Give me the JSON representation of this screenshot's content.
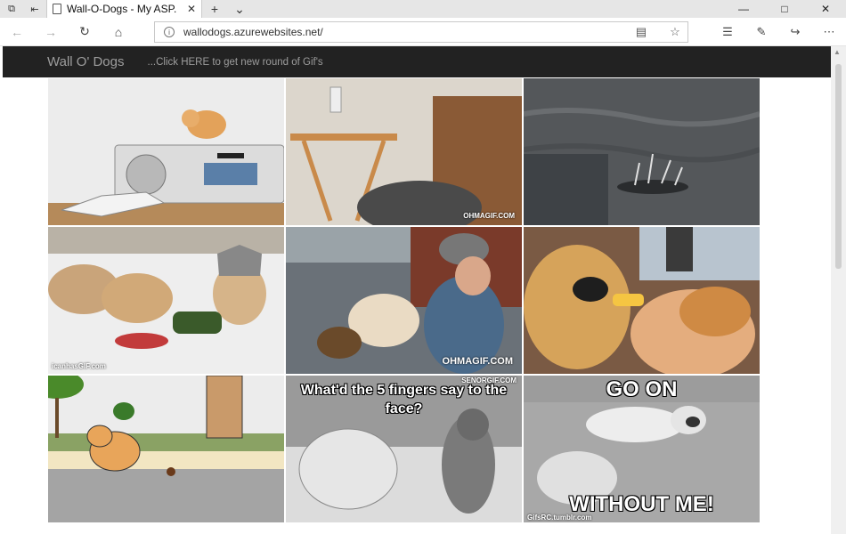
{
  "browser": {
    "tab_title": "Wall-O-Dogs - My ASP.",
    "url": "wallodogs.azurewebsites.net/"
  },
  "site": {
    "brand": "Wall O' Dogs",
    "refresh_link": "...Click HERE to get new round of Gif's"
  },
  "tiles": [
    {
      "caption_top": "",
      "caption_bottom": "",
      "watermark": ""
    },
    {
      "caption_top": "",
      "caption_bottom": "",
      "watermark": "OHMAGIF.COM"
    },
    {
      "caption_top": "",
      "caption_bottom": "",
      "watermark": ""
    },
    {
      "caption_top": "",
      "caption_bottom": "",
      "watermark": "icanhasGIF.com"
    },
    {
      "caption_top": "",
      "caption_bottom": "",
      "watermark": "OHMAGIF.COM"
    },
    {
      "caption_top": "",
      "caption_bottom": "",
      "watermark": ""
    },
    {
      "caption_top": "",
      "caption_bottom": "",
      "watermark": ""
    },
    {
      "caption_top": "What'd the 5 fingers say to the face?",
      "caption_bottom": "",
      "watermark": "SENORGIF.COM"
    },
    {
      "caption_top": "GO ON",
      "caption_bottom": "WITHOUT ME!",
      "watermark": "GifsRC.tumblr.com"
    }
  ]
}
